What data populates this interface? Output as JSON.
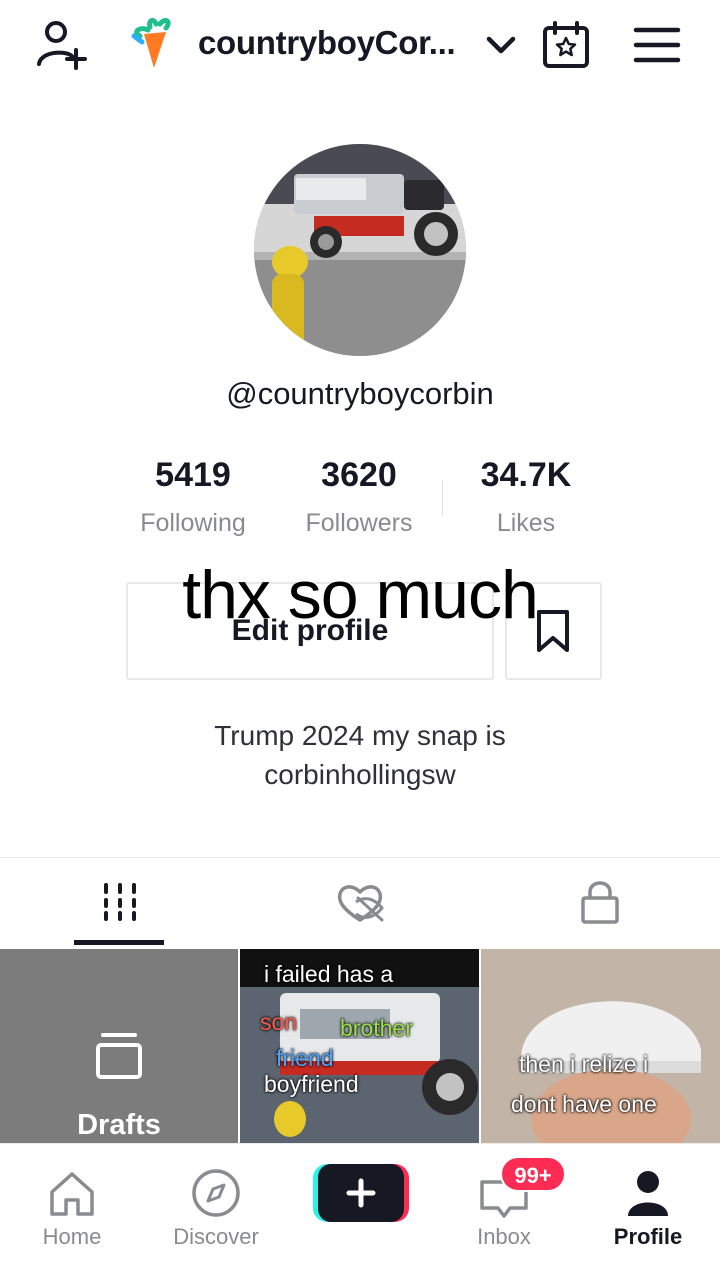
{
  "header": {
    "username": "countryboyCor...",
    "icons": [
      "add-friend-icon",
      "carrot-icon",
      "chevron-down-icon",
      "calendar-star-icon",
      "menu-icon"
    ]
  },
  "profile": {
    "handle": "@countryboycorbin",
    "stats": [
      {
        "value": "5419",
        "label": "Following"
      },
      {
        "value": "3620",
        "label": "Followers"
      },
      {
        "value": "34.7K",
        "label": "Likes"
      }
    ],
    "edit_label": "Edit profile",
    "bio_line1": "Trump 2024 my snap is",
    "bio_line2": "corbinhollingsw"
  },
  "overlay": {
    "caption": "thx so much"
  },
  "tabs": [
    {
      "name": "videos",
      "icon": "grid-icon",
      "active": true
    },
    {
      "name": "liked",
      "icon": "liked-hidden-icon",
      "active": false
    },
    {
      "name": "private",
      "icon": "lock-icon",
      "active": false
    }
  ],
  "grid": {
    "drafts_label": "Drafts",
    "video1_caption_line1": "i failed has a",
    "video1_caption_son": "son",
    "video1_caption_brother": "brother",
    "video1_caption_friend": "friend",
    "video1_caption_boyfriend": "boyfriend",
    "video2_caption_line1": "then i relize i",
    "video2_caption_line2": "dont have one"
  },
  "nav": {
    "home": "Home",
    "discover": "Discover",
    "inbox": "Inbox",
    "inbox_badge": "99+",
    "profile": "Profile"
  },
  "colors": {
    "accent_red": "#fe2c55",
    "accent_cyan": "#25f4ee",
    "text": "#161823",
    "muted": "#8a8b91"
  }
}
